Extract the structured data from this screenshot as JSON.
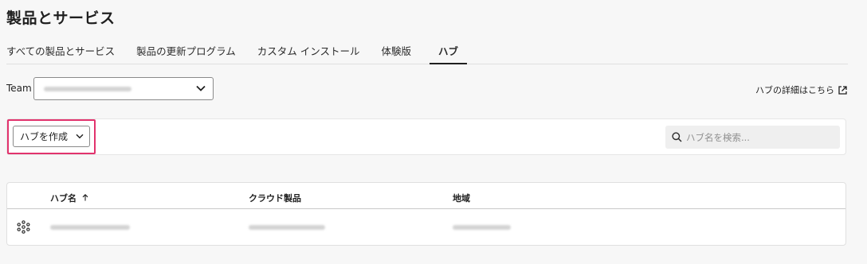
{
  "page": {
    "title": "製品とサービス"
  },
  "tabs": [
    {
      "label": "すべての製品とサービス"
    },
    {
      "label": "製品の更新プログラム"
    },
    {
      "label": "カスタム インストール"
    },
    {
      "label": "体験版"
    },
    {
      "label": "ハブ",
      "active": true
    }
  ],
  "team": {
    "label": "Team"
  },
  "hub_link": {
    "label": "ハブの詳細はこちら"
  },
  "toolbar": {
    "create_label": "ハブを作成"
  },
  "search": {
    "placeholder": "ハブ名を検索..."
  },
  "table": {
    "columns": [
      {
        "label": "ハブ名",
        "sort": "ascending"
      },
      {
        "label": "クラウド製品"
      },
      {
        "label": "地域"
      }
    ]
  },
  "colors": {
    "highlight": "#e2336d",
    "accent_text": "#1f1f1f"
  },
  "icons": {
    "sort": "arrow-up-icon",
    "row": "hub-icon",
    "search": "search-icon",
    "external": "external-link-icon",
    "dropdown": "chevron-down-icon"
  }
}
